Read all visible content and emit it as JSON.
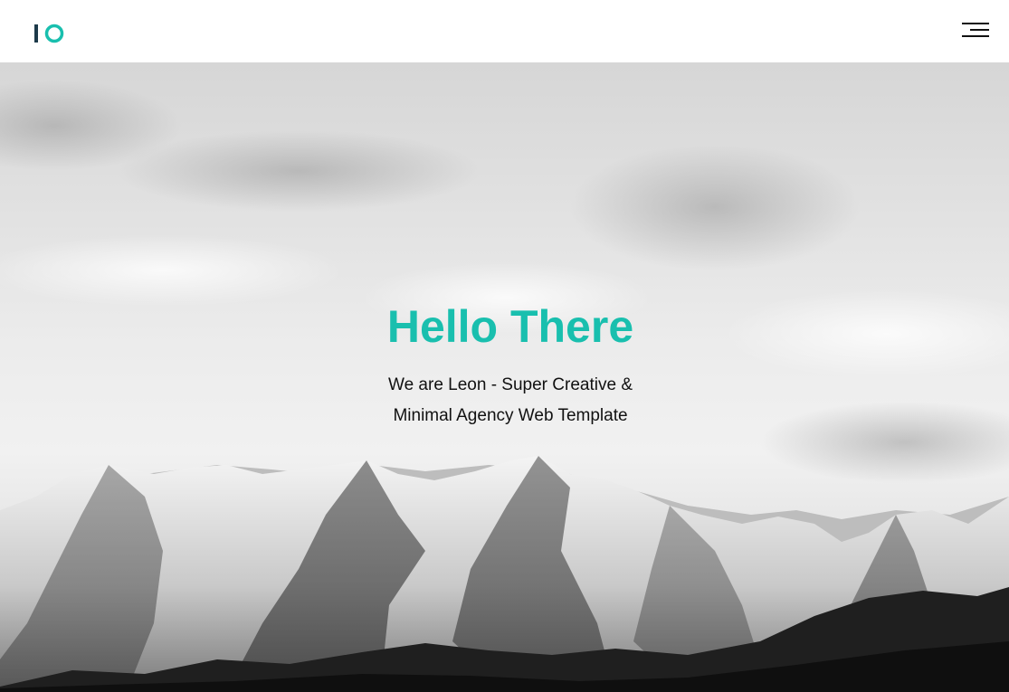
{
  "header": {
    "logo": {
      "letters": "IO",
      "bar_color": "#1d3a4a",
      "ring_color": "#19bfae"
    },
    "menu_icon": "hamburger-menu-icon"
  },
  "hero": {
    "title": "Hello There",
    "subtitle_line1": "We are Leon - Super Creative &",
    "subtitle_line2": "Minimal Agency Web Template",
    "background": "snowy-mountains-grayscale-photo",
    "title_color": "#19bfae"
  }
}
